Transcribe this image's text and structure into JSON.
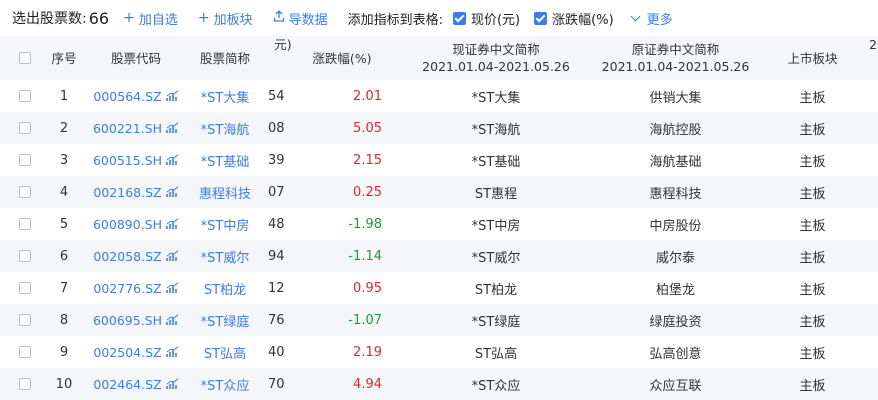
{
  "toolbar": {
    "count_label": "选出股票数:",
    "count": "66",
    "add_watchlist": "加自选",
    "add_board": "加板块",
    "export": "导数据",
    "add_indicator_label": "添加指标到表格:",
    "check_price": "现价(元)",
    "check_change": "涨跌幅(%)",
    "more": "更多"
  },
  "table": {
    "headers": {
      "index": "序号",
      "code": "股票代码",
      "name": "股票简称",
      "price_clipped": "元)",
      "change": "涨跌幅(%)",
      "current_name_line1": "现证券中文简称",
      "current_name_line2": "2021.01.04-2021.05.26",
      "original_name_line1": "原证券中文简称",
      "original_name_line2": "2021.01.04-2021.05.26",
      "board": "上市板块",
      "extra_clipped": "2"
    },
    "rows": [
      {
        "index": "1",
        "code": "000564.SZ",
        "name": "*ST大集",
        "price_clipped": "54",
        "change": "2.01",
        "dir": "up",
        "current_name": "*ST大集",
        "original_name": "供销大集",
        "board": "主板"
      },
      {
        "index": "2",
        "code": "600221.SH",
        "name": "*ST海航",
        "price_clipped": "08",
        "change": "5.05",
        "dir": "up",
        "current_name": "*ST海航",
        "original_name": "海航控股",
        "board": "主板"
      },
      {
        "index": "3",
        "code": "600515.SH",
        "name": "*ST基础",
        "price_clipped": "39",
        "change": "2.15",
        "dir": "up",
        "current_name": "*ST基础",
        "original_name": "海航基础",
        "board": "主板"
      },
      {
        "index": "4",
        "code": "002168.SZ",
        "name": "惠程科技",
        "price_clipped": "07",
        "change": "0.25",
        "dir": "up",
        "current_name": "ST惠程",
        "original_name": "惠程科技",
        "board": "主板"
      },
      {
        "index": "5",
        "code": "600890.SH",
        "name": "*ST中房",
        "price_clipped": "48",
        "change": "-1.98",
        "dir": "down",
        "current_name": "*ST中房",
        "original_name": "中房股份",
        "board": "主板"
      },
      {
        "index": "6",
        "code": "002058.SZ",
        "name": "*ST威尔",
        "price_clipped": "94",
        "change": "-1.14",
        "dir": "down",
        "current_name": "*ST威尔",
        "original_name": "威尔泰",
        "board": "主板"
      },
      {
        "index": "7",
        "code": "002776.SZ",
        "name": "ST柏龙",
        "price_clipped": "12",
        "change": "0.95",
        "dir": "up",
        "current_name": "ST柏龙",
        "original_name": "柏堡龙",
        "board": "主板"
      },
      {
        "index": "8",
        "code": "600695.SH",
        "name": "*ST绿庭",
        "price_clipped": "76",
        "change": "-1.07",
        "dir": "down",
        "current_name": "*ST绿庭",
        "original_name": "绿庭投资",
        "board": "主板"
      },
      {
        "index": "9",
        "code": "002504.SZ",
        "name": "ST弘高",
        "price_clipped": "40",
        "change": "2.19",
        "dir": "up",
        "current_name": "ST弘高",
        "original_name": "弘高创意",
        "board": "主板"
      },
      {
        "index": "10",
        "code": "002464.SZ",
        "name": "*ST众应",
        "price_clipped": "70",
        "change": "4.94",
        "dir": "up",
        "current_name": "*ST众应",
        "original_name": "众应互联",
        "board": "主板"
      }
    ]
  },
  "colors": {
    "accent": "#3b7cf0",
    "up": "#e0282e",
    "down": "#1f9b3b",
    "header_bg": "#f4f6fa"
  },
  "icons": {
    "add": "plus-icon",
    "export": "upload-icon",
    "more": "chevron-down-icon",
    "code_chart": "bar-chart-icon"
  }
}
